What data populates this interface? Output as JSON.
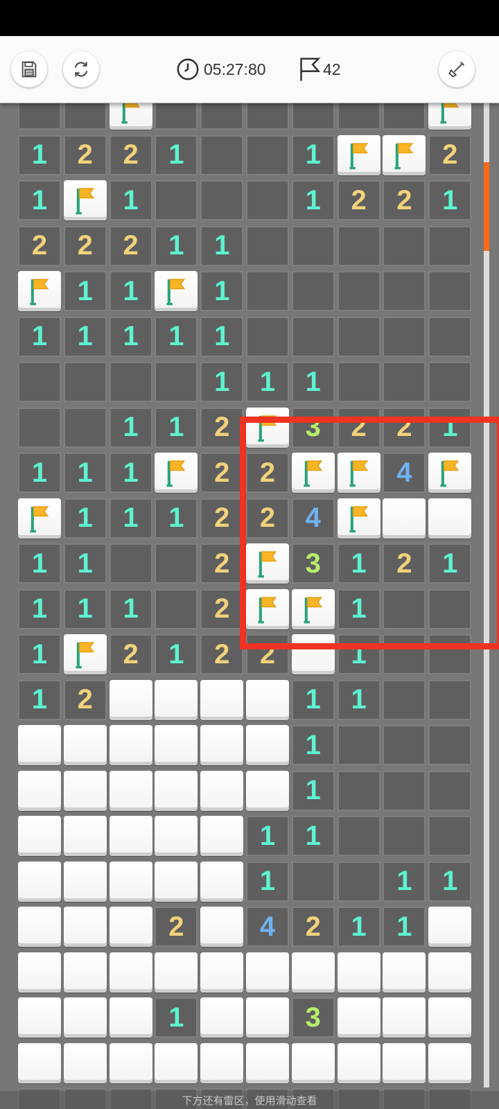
{
  "toolbar": {
    "save_icon": "save-icon",
    "restart_icon": "restart-icon",
    "timer": "05:27:80",
    "timer_icon": "clock-icon",
    "flags_left": "42",
    "flag_icon": "flag-icon",
    "tool_icon": "shovel-icon"
  },
  "board": {
    "columns": 10,
    "rows": [
      [
        "O",
        "O",
        "F",
        "O",
        "O",
        "O",
        "O",
        "O",
        "O",
        "F"
      ],
      [
        "1",
        "2",
        "2",
        "1",
        "O",
        "O",
        "1",
        "F",
        "F",
        "2"
      ],
      [
        "1",
        "F",
        "1",
        "O",
        "O",
        "O",
        "1",
        "2",
        "2",
        "1"
      ],
      [
        "2",
        "2",
        "2",
        "1",
        "1",
        "O",
        "O",
        "O",
        "O",
        "O"
      ],
      [
        "F",
        "1",
        "1",
        "F",
        "1",
        "O",
        "O",
        "O",
        "O",
        "O"
      ],
      [
        "1",
        "1",
        "1",
        "1",
        "1",
        "O",
        "O",
        "O",
        "O",
        "O"
      ],
      [
        "O",
        "O",
        "O",
        "O",
        "1",
        "1",
        "1",
        "O",
        "O",
        "O"
      ],
      [
        "O",
        "O",
        "1",
        "1",
        "2",
        "F",
        "3",
        "2",
        "2",
        "1"
      ],
      [
        "1",
        "1",
        "1",
        "F",
        "2",
        "2",
        "F",
        "F",
        "4",
        "F"
      ],
      [
        "F",
        "1",
        "1",
        "1",
        "2",
        "2",
        "4",
        "F",
        "C",
        "C"
      ],
      [
        "1",
        "1",
        "O",
        "O",
        "2",
        "F",
        "3",
        "1",
        "2",
        "1"
      ],
      [
        "1",
        "1",
        "1",
        "O",
        "2",
        "F",
        "F",
        "1",
        "O",
        "O"
      ],
      [
        "1",
        "F",
        "2",
        "1",
        "2",
        "2",
        "C",
        "1",
        "O",
        "O"
      ],
      [
        "1",
        "2",
        "C",
        "C",
        "C",
        "C",
        "1",
        "1",
        "O",
        "O"
      ],
      [
        "C",
        "C",
        "C",
        "C",
        "C",
        "C",
        "1",
        "O",
        "O",
        "O"
      ],
      [
        "C",
        "C",
        "C",
        "C",
        "C",
        "C",
        "1",
        "O",
        "O",
        "O"
      ],
      [
        "C",
        "C",
        "C",
        "C",
        "C",
        "1",
        "1",
        "O",
        "O",
        "O"
      ],
      [
        "C",
        "C",
        "C",
        "C",
        "C",
        "1",
        "O",
        "O",
        "1",
        "1"
      ],
      [
        "C",
        "C",
        "C",
        "2",
        "C",
        "4",
        "2",
        "1",
        "1",
        "C"
      ],
      [
        "C",
        "C",
        "C",
        "C",
        "C",
        "C",
        "C",
        "C",
        "C",
        "C"
      ],
      [
        "C",
        "C",
        "C",
        "1",
        "C",
        "C",
        "3",
        "C",
        "C",
        "C"
      ],
      [
        "C",
        "C",
        "C",
        "C",
        "C",
        "C",
        "C",
        "C",
        "C",
        "C"
      ],
      [
        "O",
        "O",
        "O",
        "O",
        "O",
        "O",
        "O",
        "O",
        "O",
        "O"
      ]
    ],
    "number_colors": {
      "1": "#5ef2d0",
      "2": "#f2d27a",
      "3": "#b7ef6a",
      "4": "#6fb2f0"
    }
  },
  "scroll": {
    "position": 0.06,
    "extent": 0.09
  },
  "hint_text": "下方还有雷区，使用滑动查看"
}
